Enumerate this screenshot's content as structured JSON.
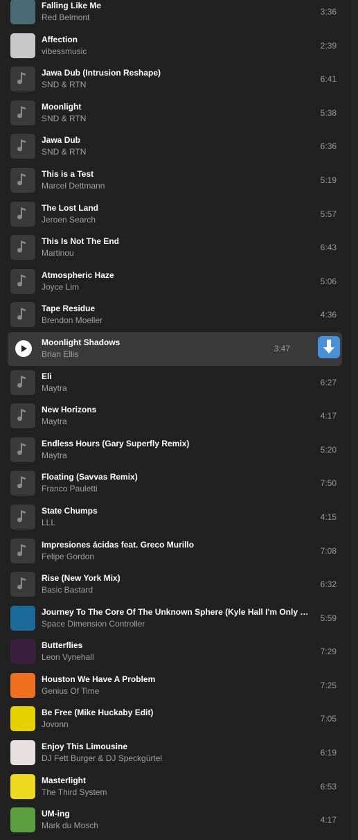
{
  "colors": {
    "background": "#212121",
    "accent": "#4a90d9",
    "active_row": "#3a3a3a"
  },
  "icons": {
    "placeholder": "music-note-icon",
    "play": "play-icon",
    "download": "download-arrow-icon"
  },
  "tracks": [
    {
      "title": "Falling Like Me",
      "artist": "Red Belmont",
      "duration": "3:36",
      "art": "#4a6a78"
    },
    {
      "title": "Affection",
      "artist": "vibessmusic",
      "duration": "2:39",
      "art": "#c8c8c8"
    },
    {
      "title": "Jawa Dub (Intrusion Reshape)",
      "artist": "SND & RTN",
      "duration": "6:41"
    },
    {
      "title": "Moonlight",
      "artist": "SND & RTN",
      "duration": "5:38"
    },
    {
      "title": "Jawa Dub",
      "artist": "SND & RTN",
      "duration": "6:36"
    },
    {
      "title": "This is a Test",
      "artist": "Marcel Dettmann",
      "duration": "5:19"
    },
    {
      "title": "The Lost Land",
      "artist": "Jeroen Search",
      "duration": "5:57"
    },
    {
      "title": "This Is Not The End",
      "artist": "Martinou",
      "duration": "6:43"
    },
    {
      "title": "Atmospheric Haze",
      "artist": "Joyce Lim",
      "duration": "5:06"
    },
    {
      "title": "Tape Residue",
      "artist": "Brendon Moeller",
      "duration": "4:36"
    },
    {
      "title": "Moonlight Shadows",
      "artist": "Brian Ellis",
      "duration": "3:47",
      "active": true
    },
    {
      "title": "Eli",
      "artist": "Maytra",
      "duration": "6:27"
    },
    {
      "title": "New Horizons",
      "artist": "Maytra",
      "duration": "4:17"
    },
    {
      "title": "Endless Hours (Gary Superfly Remix)",
      "artist": "Maytra",
      "duration": "5:20"
    },
    {
      "title": "Floating (Savvas Remix)",
      "artist": "Franco Pauletti",
      "duration": "7:50"
    },
    {
      "title": "State Chumps",
      "artist": "LLL",
      "duration": "4:15"
    },
    {
      "title": "Impresiones ácidas feat. Greco Murillo",
      "artist": "Felipe Gordon",
      "duration": "7:08"
    },
    {
      "title": "Rise (New York Mix)",
      "artist": "Basic Bastard",
      "duration": "6:32"
    },
    {
      "title": "Journey To The Core Of The Unknown Sphere (Kyle Hall I'm Only Breathing Mix)",
      "artist": "Space Dimension Controller",
      "duration": "5:59",
      "art": "#1a6a9a"
    },
    {
      "title": "Butterflies",
      "artist": "Leon Vynehall",
      "duration": "7:29",
      "art": "#3a1f3f"
    },
    {
      "title": "Houston We Have A Problem",
      "artist": "Genius Of Time",
      "duration": "7:25",
      "art": "#f07020"
    },
    {
      "title": "Be Free (Mike Huckaby Edit)",
      "artist": "Jovonn",
      "duration": "7:05",
      "art": "#e8d000"
    },
    {
      "title": "Enjoy This Limousine",
      "artist": "DJ Fett Burger & DJ Speckgürtel",
      "duration": "6:19",
      "art": "#e8e0e0"
    },
    {
      "title": "Masterlight",
      "artist": "The Third System",
      "duration": "6:53",
      "art": "#f0d820"
    },
    {
      "title": "UM-ing",
      "artist": "Mark du Mosch",
      "duration": "4:17",
      "art": "#5aa040"
    }
  ]
}
